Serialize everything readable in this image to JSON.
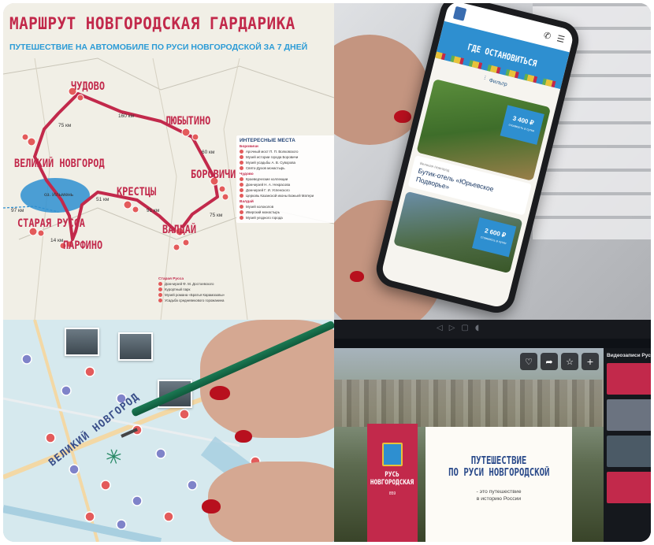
{
  "map": {
    "title": "Маршрут Новгородская Гардарика",
    "subtitle": "ПУТЕШЕСТВИЕ НА АВТОМОБИЛЕ ПО РУСИ НОВГОРОДСКОЙ ЗА 7 ДНЕЙ",
    "cities": [
      "ЧУДОВО",
      "ЛЮБЫТИНО",
      "ВЕЛИКИЙ НОВГОРОД",
      "БОРОВИЧИ",
      "КРЕСТЦЫ",
      "СТАРАЯ РУССА",
      "ВАЛДАЙ",
      "ПАРФИНО"
    ],
    "distances": [
      "160 км",
      "75 км",
      "60 км",
      "97 км",
      "91 км",
      "75 км",
      "51 км",
      "14 км"
    ],
    "lake": "оз. Ильмень",
    "legend": {
      "heading": "ИНТЕРЕСНЫЕ МЕСТА",
      "groups": [
        {
          "title": "Боровичи",
          "items": [
            "Арочный мост П. П. Волковского",
            "Музей истории города Боровичи",
            "Музей усадьбы А. В. Суворова",
            "Свято-Духов монастырь"
          ]
        },
        {
          "title": "Чудово",
          "items": [
            "Краеведческие коллекции",
            "Дом-музей Н. А. Некрасова",
            "Дом-музей Г. И. Успенского",
            "Церковь Казанской иконы Божьей Матери"
          ]
        },
        {
          "title": "Валдай",
          "items": [
            "Музей колоколов",
            "Иверский монастырь",
            "Музей уездного города"
          ]
        }
      ]
    },
    "legend2": {
      "title": "Старая Русса",
      "items": [
        "Дом-музей Ф. М. Достоевского",
        "Курортный парк",
        "Музей романа «Братья Карамазовы»",
        "Усадьба средневекового горожанина"
      ]
    }
  },
  "phone": {
    "banner_title": "Где остановиться",
    "filter_label": "Фильтр",
    "card1": {
      "price": "3 400 ₽",
      "price_note": "стоимость в сутки",
      "category": "Великая Новгород",
      "name": "Бутик-отель «Юрьевское Подворье»"
    },
    "card2": {
      "price": "2 600 ₽",
      "price_note": "стоимость в сутки"
    }
  },
  "drawing": {
    "strip_label": "ВЕЛИКИЙ НОВГОРОД"
  },
  "video": {
    "actions": [
      "♡",
      "➦",
      "☆",
      "+"
    ],
    "badge_text": "Русь Новгородская",
    "badge_year": "859",
    "card_title_line1": "ПУТЕШЕСТВИЕ",
    "card_title_line2": "ПО РУСИ НОВГОРОДСКОЙ",
    "card_sub_line1": "- это путешествие",
    "card_sub_line2": "в историю России",
    "sidebar_title": "Видеозаписи Русь Н"
  },
  "colors": {
    "brand_red": "#c2294b",
    "brand_blue": "#2e8fd0",
    "accent_yellow": "#e8c23a"
  }
}
